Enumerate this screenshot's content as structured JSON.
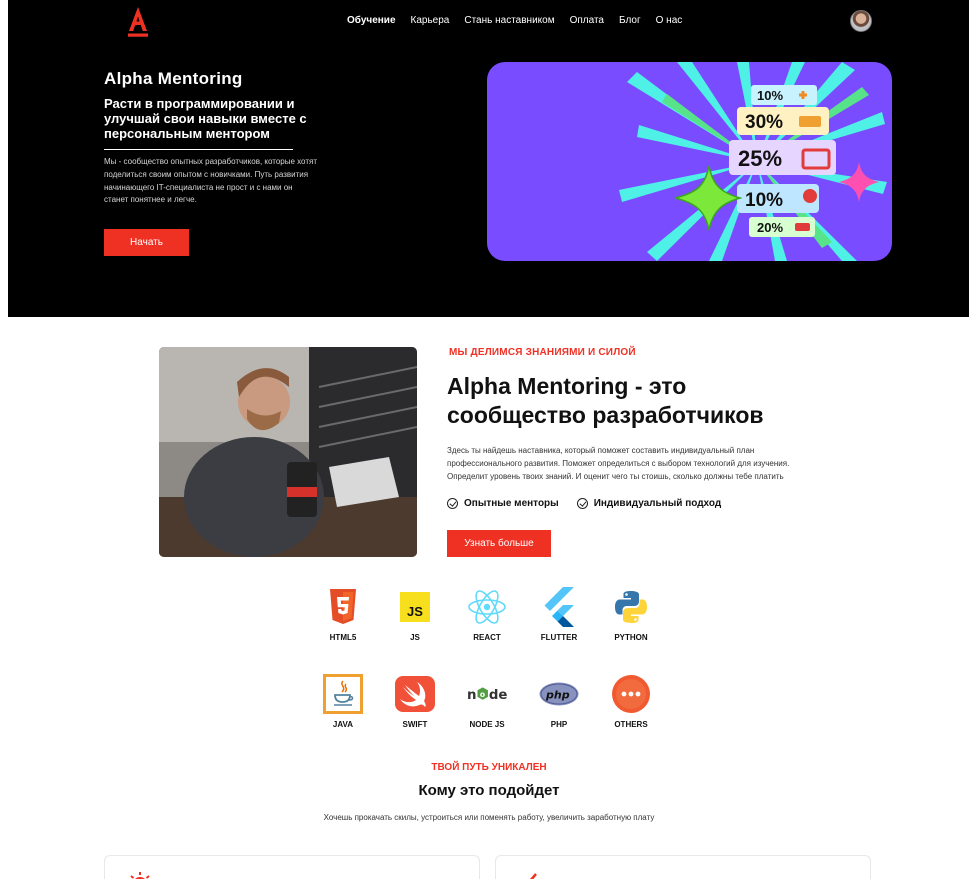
{
  "nav": {
    "items": [
      {
        "label": "Обучение",
        "active": true
      },
      {
        "label": "Карьера",
        "active": false
      },
      {
        "label": "Стань наставником",
        "active": false
      },
      {
        "label": "Оплата",
        "active": false
      },
      {
        "label": "Блог",
        "active": false
      },
      {
        "label": "О нас",
        "active": false
      }
    ]
  },
  "hero": {
    "title": "Alpha Mentoring",
    "subtitle": "Расти в программировании и улучшай свои навыки вместе с персональным ментором",
    "text": "Мы - сообщество опытных разработчиков, которые хотят поделиться своим опытом с новичками. Путь развития начинающего IT-специалиста не прост и с нами он станет понятнее и легче.",
    "button": "Начать"
  },
  "promo": {
    "badges": [
      "10%",
      "30%",
      "25%",
      "10%",
      "20%"
    ]
  },
  "about": {
    "eyebrow": "МЫ ДЕЛИМСЯ ЗНАНИЯМИ И СИЛОЙ",
    "title": "Alpha Mentoring - это сообщество разработчиков",
    "text": "Здесь ты найдешь наставника, который поможет составить индивидуальный план профессионального развития. Поможет определиться с выбором технологий для изучения. Определит уровень твоих знаний. И оценит чего ты стоишь, сколько должны тебе платить",
    "features": [
      "Опытные менторы",
      "Индивидуальный подход"
    ],
    "button": "Узнать больше"
  },
  "tech": {
    "items": [
      {
        "label": "HTML5",
        "icon": "html5-icon"
      },
      {
        "label": "JS",
        "icon": "js-icon"
      },
      {
        "label": "REACT",
        "icon": "react-icon"
      },
      {
        "label": "FLUTTER",
        "icon": "flutter-icon"
      },
      {
        "label": "PYTHON",
        "icon": "python-icon"
      },
      {
        "label": "JAVA",
        "icon": "java-icon"
      },
      {
        "label": "SWIFT",
        "icon": "swift-icon"
      },
      {
        "label": "NODE JS",
        "icon": "nodejs-icon"
      },
      {
        "label": "PHP",
        "icon": "php-icon"
      },
      {
        "label": "OTHERS",
        "icon": "others-icon"
      }
    ]
  },
  "fit": {
    "eyebrow": "ТВОЙ ПУТЬ УНИКАЛЕН",
    "title": "Кому это подойдет",
    "text": "Хочешь прокачать скилы, устроиться или поменять работу, увеличить заработную плату"
  },
  "colors": {
    "accent": "#ef3124",
    "hero_bg": "#000000",
    "promo_bg": "#7a4cff"
  }
}
